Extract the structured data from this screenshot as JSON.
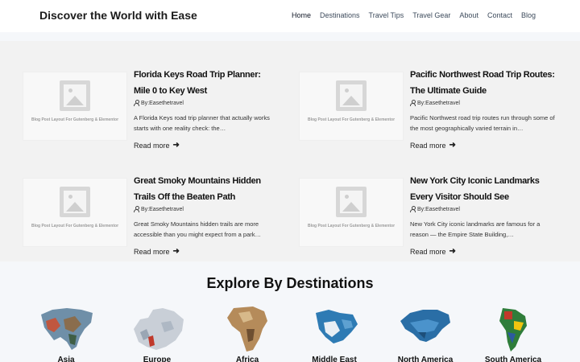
{
  "header": {
    "brand": "Discover the World with Ease",
    "nav": [
      "Home",
      "Destinations",
      "Travel Tips",
      "Travel Gear",
      "About",
      "Contact",
      "Blog"
    ]
  },
  "posts": [
    {
      "title": "Florida Keys Road Trip Planner: Mile 0 to Key West",
      "author": "By:Easethetravel",
      "excerpt": "A Florida Keys road trip planner that actually works starts with one reality check: the…",
      "thumb_caption": "Blog Post Layout For Gutenberg & Elementor",
      "more": "Read more"
    },
    {
      "title": "Pacific Northwest Road Trip Routes: The Ultimate Guide",
      "author": "By:Easethetravel",
      "excerpt": "Pacific Northwest road trip routes run through some of the most geographically varied terrain in…",
      "thumb_caption": "Blog Post Layout For Gutenberg & Elementor",
      "more": "Read more"
    },
    {
      "title": "Great Smoky Mountains Hidden Trails Off the Beaten Path",
      "author": "By:Easethetravel",
      "excerpt": "Great Smoky Mountains hidden trails are more accessible than you might expect from a park…",
      "thumb_caption": "Blog Post Layout For Gutenberg & Elementor",
      "more": "Read more"
    },
    {
      "title": "New York City Iconic Landmarks Every Visitor Should See",
      "author": "By:Easethetravel",
      "excerpt": "New York City iconic landmarks are famous for a reason — the Empire State Building,…",
      "thumb_caption": "Blog Post Layout For Gutenberg & Elementor",
      "more": "Read more"
    }
  ],
  "destinations": {
    "title": "Explore By Destinations",
    "regions": [
      "Asia",
      "Europe",
      "Africa",
      "Middle East",
      "North America",
      "South America"
    ]
  },
  "colors": {
    "background": "#f2f2f2",
    "accent": "#111111"
  }
}
